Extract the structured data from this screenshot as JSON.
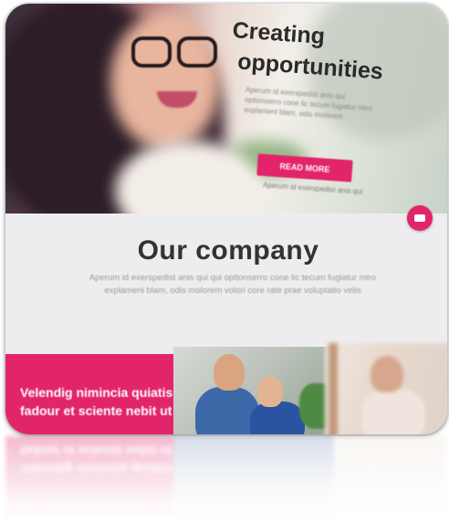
{
  "hero": {
    "title_line1": "Creating",
    "title_line2": "opportunities",
    "body": "Aperum id exerspedist anis qui optionserro cone lic tecum fugiatur miro explameni blam, odis molorem",
    "button_label": "READ MORE",
    "caption": "Aperum id exerspedist anis qui"
  },
  "company": {
    "title": "Our company",
    "text": "Aperum id exerspedist anis qui qui optionserro cone lic tecum fugiatur miro explameni blam, odis molorem volori core rate prae voluptatio velis"
  },
  "tile": {
    "text": "Velendig nimincia quiatis fadour et sciente nebit ut"
  },
  "colors": {
    "accent": "#e2246a",
    "background": "#ededf0"
  },
  "icons": {
    "fab": "chat-icon"
  }
}
